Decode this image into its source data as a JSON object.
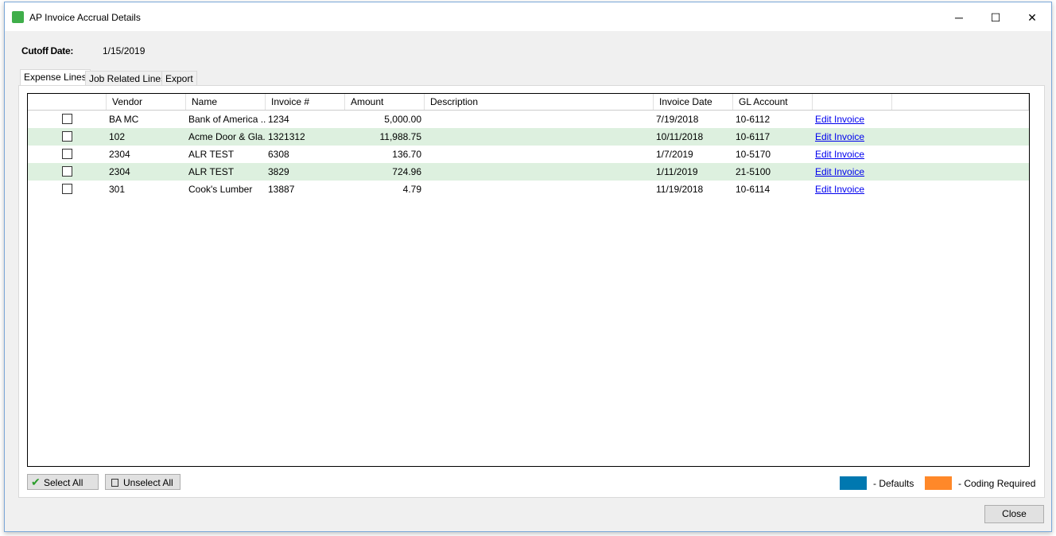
{
  "window": {
    "title": "AP Invoice Accrual Details",
    "icon": "sage-app-icon",
    "minimize": "─",
    "maximize": "☐",
    "close": "✕"
  },
  "cutoff": {
    "label": "Cutoff Date:",
    "value": "1/15/2019"
  },
  "tabs": [
    {
      "label": "Expense Lines",
      "active": true
    },
    {
      "label": "Job Related Lines"
    },
    {
      "label": "Export"
    }
  ],
  "grid": {
    "columns": [
      "",
      "Vendor",
      "Name",
      "Invoice #",
      "Amount",
      "Description",
      "Invoice Date",
      "GL Account",
      ""
    ],
    "rows": [
      {
        "checked": false,
        "vendor": "BA MC",
        "name": "Bank of America ...",
        "invoice": "1234",
        "amount": "5,000.00",
        "description": "",
        "date": "7/19/2018",
        "gl": "10-6112",
        "link": "Edit Invoice"
      },
      {
        "checked": false,
        "vendor": "102",
        "name": "Acme Door & Gla...",
        "invoice": "1321312",
        "amount": "11,988.75",
        "description": "",
        "date": "10/11/2018",
        "gl": "10-6117",
        "link": "Edit Invoice"
      },
      {
        "checked": false,
        "vendor": "2304",
        "name": "ALR TEST",
        "invoice": "6308",
        "amount": "136.70",
        "description": "",
        "date": "1/7/2019",
        "gl": "10-5170",
        "link": "Edit Invoice"
      },
      {
        "checked": false,
        "vendor": "2304",
        "name": "ALR TEST",
        "invoice": "3829",
        "amount": "724.96",
        "description": "",
        "date": "1/11/2019",
        "gl": "21-5100",
        "link": "Edit Invoice"
      },
      {
        "checked": false,
        "vendor": "301",
        "name": "Cook's Lumber",
        "invoice": "13887",
        "amount": "4.79",
        "description": "",
        "date": "11/19/2018",
        "gl": "10-6114",
        "link": "Edit Invoice"
      }
    ]
  },
  "buttons": {
    "select_all": "Select All",
    "unselect_all": "Unselect All",
    "close": "Close"
  },
  "legend": [
    {
      "label": "- Defaults",
      "color": "#0078b0"
    },
    {
      "label": "- Coding Required",
      "color": "#ff8829"
    }
  ]
}
